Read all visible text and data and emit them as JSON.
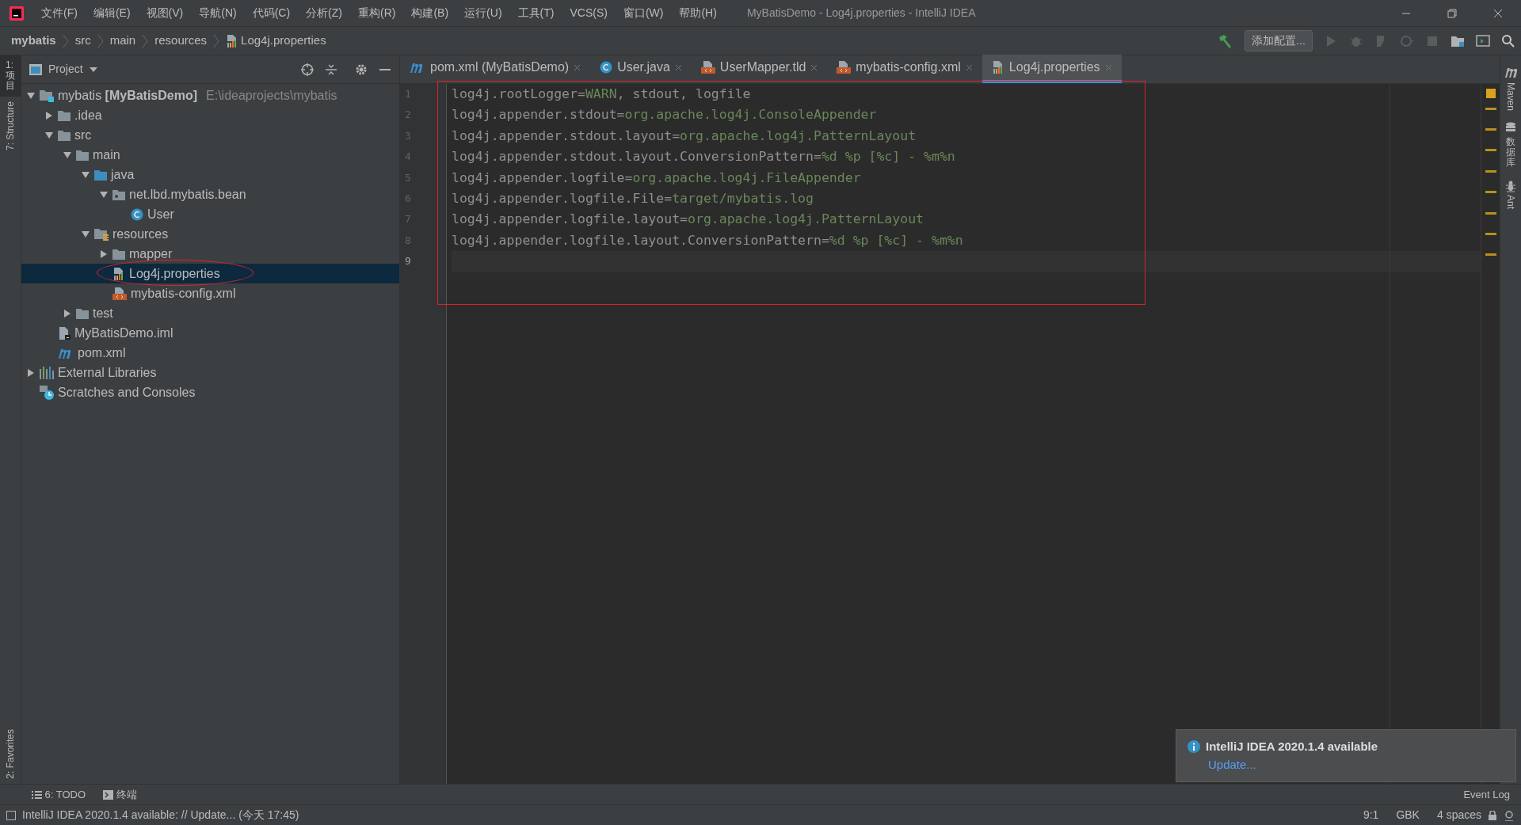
{
  "window": {
    "title": "MyBatisDemo - Log4j.properties - IntelliJ IDEA"
  },
  "menu": [
    "文件(F)",
    "编辑(E)",
    "视图(V)",
    "导航(N)",
    "代码(C)",
    "分析(Z)",
    "重构(R)",
    "构建(B)",
    "运行(U)",
    "工具(T)",
    "VCS(S)",
    "窗口(W)",
    "帮助(H)"
  ],
  "breadcrumbs": [
    {
      "label": "mybatis",
      "bold": true
    },
    {
      "label": "src",
      "bold": false
    },
    {
      "label": "main",
      "bold": false
    },
    {
      "label": "resources",
      "bold": false
    },
    {
      "label": "Log4j.properties",
      "bold": false,
      "kind": "properties"
    }
  ],
  "toolbar": {
    "run_config": "添加配置..."
  },
  "left_strip": [
    {
      "label": "1: 项目",
      "selected": true,
      "kind": "folder"
    },
    {
      "label": "7: Structure",
      "selected": false,
      "kind": "structure"
    },
    {
      "label": "2: Favorites",
      "selected": false,
      "kind": "star"
    }
  ],
  "right_strip": [
    {
      "label": "Maven",
      "kind": "maven"
    },
    {
      "label": "数据库",
      "kind": "database"
    },
    {
      "label": "Ant",
      "kind": "ant"
    }
  ],
  "project_panel": {
    "title": "Project",
    "tree": [
      {
        "label": "mybatis **[MyBatisDemo]**",
        "hint": "E:\\ideaprojects\\mybatis",
        "kind": "module",
        "expanded": true,
        "selected": false,
        "children": [
          {
            "label": ".idea",
            "kind": "folder",
            "expanded": false,
            "selected": false
          },
          {
            "label": "src",
            "kind": "folder",
            "expanded": true,
            "selected": false,
            "children": [
              {
                "label": "main",
                "kind": "folder",
                "expanded": true,
                "selected": false,
                "children": [
                  {
                    "label": "java",
                    "kind": "source",
                    "expanded": true,
                    "selected": false,
                    "children": [
                      {
                        "label": "net.lbd.mybatis.bean",
                        "kind": "package",
                        "expanded": true,
                        "selected": false,
                        "children": [
                          {
                            "label": "User",
                            "kind": "class",
                            "selected": false
                          }
                        ]
                      }
                    ]
                  },
                  {
                    "label": "resources",
                    "kind": "resources",
                    "expanded": true,
                    "selected": false,
                    "children": [
                      {
                        "label": "mapper",
                        "kind": "folder",
                        "expanded": false,
                        "selected": false
                      },
                      {
                        "label": "Log4j.properties",
                        "kind": "properties",
                        "selected": true
                      },
                      {
                        "label": "mybatis-config.xml",
                        "kind": "xml",
                        "selected": false
                      }
                    ]
                  }
                ]
              },
              {
                "label": "test",
                "kind": "folder",
                "expanded": false,
                "selected": false
              }
            ]
          },
          {
            "label": "MyBatisDemo.iml",
            "kind": "iml",
            "selected": false
          },
          {
            "label": "pom.xml",
            "kind": "maven",
            "selected": false
          }
        ]
      },
      {
        "label": "External Libraries",
        "kind": "libraries",
        "expanded": false,
        "selected": false
      },
      {
        "label": "Scratches and Consoles",
        "kind": "scratches",
        "selected": false
      }
    ]
  },
  "tabs": [
    {
      "label": "pom.xml (MyBatisDemo)",
      "kind": "maven",
      "selected": false
    },
    {
      "label": "User.java",
      "kind": "class",
      "selected": false
    },
    {
      "label": "UserMapper.tld",
      "kind": "tld",
      "selected": false
    },
    {
      "label": "mybatis-config.xml",
      "kind": "xml",
      "selected": false
    },
    {
      "label": "Log4j.properties",
      "kind": "properties",
      "selected": true
    }
  ],
  "editor": {
    "lines": [
      {
        "number": "1",
        "current": false,
        "segments": [
          {
            "text": "log4j.rootLogger=",
            "kind": "key"
          },
          {
            "text": "WARN",
            "kind": "value"
          },
          {
            "text": ", stdout, logfile",
            "kind": "key"
          }
        ]
      },
      {
        "number": "2",
        "current": false,
        "segments": [
          {
            "text": "log4j.appender.stdout=",
            "kind": "key"
          },
          {
            "text": "org.apache.log4j.ConsoleAppender",
            "kind": "value"
          }
        ]
      },
      {
        "number": "3",
        "current": false,
        "segments": [
          {
            "text": "log4j.appender.stdout.layout=",
            "kind": "key"
          },
          {
            "text": "org.apache.log4j.PatternLayout",
            "kind": "value"
          }
        ]
      },
      {
        "number": "4",
        "current": false,
        "segments": [
          {
            "text": "log4j.appender.stdout.layout.ConversionPattern=",
            "kind": "key"
          },
          {
            "text": "%d %p [%c] - %m%n",
            "kind": "value"
          }
        ]
      },
      {
        "number": "5",
        "current": false,
        "segments": [
          {
            "text": "log4j.appender.logfile=",
            "kind": "key"
          },
          {
            "text": "org.apache.log4j.FileAppender",
            "kind": "value"
          }
        ]
      },
      {
        "number": "6",
        "current": false,
        "segments": [
          {
            "text": "log4j.appender.logfile.File=",
            "kind": "key"
          },
          {
            "text": "target/mybatis.log",
            "kind": "value"
          }
        ]
      },
      {
        "number": "7",
        "current": false,
        "segments": [
          {
            "text": "log4j.appender.logfile.layout=",
            "kind": "key"
          },
          {
            "text": "org.apache.log4j.PatternLayout",
            "kind": "value"
          }
        ]
      },
      {
        "number": "8",
        "current": false,
        "segments": [
          {
            "text": "log4j.appender.logfile.layout.ConversionPattern=",
            "kind": "key"
          },
          {
            "text": "%d %p [%c] - %m%n",
            "kind": "value"
          }
        ]
      },
      {
        "number": "9",
        "current": true
      }
    ]
  },
  "bottom_tools": [
    {
      "label": "6: TODO",
      "kind": "todo"
    },
    {
      "label": "终端",
      "kind": "terminal"
    }
  ],
  "notification": {
    "title": "IntelliJ IDEA 2020.1.4 available",
    "link": "Update..."
  },
  "status_bar": {
    "message": "IntelliJ IDEA 2020.1.4 available: // Update... (今天 17:45)",
    "position": "9:1",
    "encoding": "GBK",
    "indent": "4 spaces",
    "event_log": "Event Log"
  }
}
